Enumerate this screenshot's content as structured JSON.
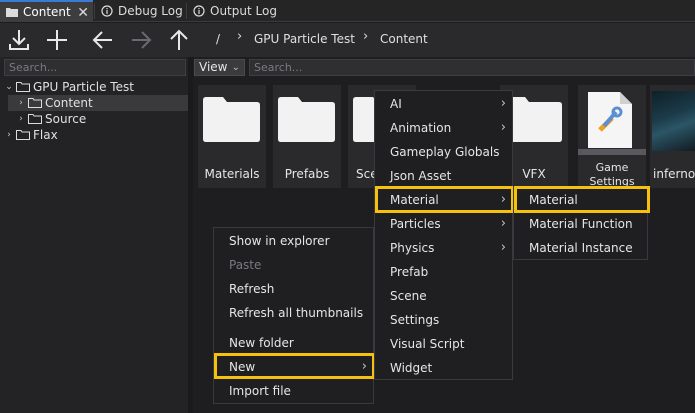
{
  "tabs": [
    {
      "label": "Content",
      "icon": "folder-icon",
      "active": true
    },
    {
      "label": "Debug Log",
      "icon": "info-icon",
      "active": false
    },
    {
      "label": "Output Log",
      "icon": "info-icon",
      "active": false
    }
  ],
  "tab_close": "✕",
  "toolbar": {
    "buttons": [
      "import-icon",
      "add-icon",
      "back-icon",
      "forward-icon",
      "up-icon"
    ],
    "breadcrumb": [
      "/",
      "GPU Particle Test",
      "Content"
    ]
  },
  "left": {
    "search_placeholder": "Search...",
    "tree": [
      {
        "label": "GPU Particle Test",
        "expanded": true
      },
      {
        "label": "Content",
        "selected": true
      },
      {
        "label": "Source"
      },
      {
        "label": "Flax"
      }
    ]
  },
  "content": {
    "view_label": "View",
    "search_placeholder": "Search...",
    "items": [
      {
        "label": "Materials"
      },
      {
        "label": "Prefabs"
      },
      {
        "label": "Sce"
      },
      {
        "label": "VFX"
      },
      {
        "label": "Game\nSettings"
      },
      {
        "label": "inferno-t"
      }
    ]
  },
  "context_menu": {
    "items": [
      {
        "label": "Show in explorer"
      },
      {
        "label": "Paste",
        "disabled": true
      },
      {
        "label": "Refresh"
      },
      {
        "label": "Refresh all thumbnails"
      },
      {
        "label": "New folder"
      },
      {
        "label": "New",
        "submenu": true,
        "highlighted": true
      },
      {
        "label": "Import file"
      }
    ]
  },
  "new_menu": {
    "items": [
      {
        "label": "AI",
        "submenu": true
      },
      {
        "label": "Animation",
        "submenu": true
      },
      {
        "label": "Gameplay Globals"
      },
      {
        "label": "Json Asset"
      },
      {
        "label": "Material",
        "submenu": true,
        "highlighted": true
      },
      {
        "label": "Particles",
        "submenu": true
      },
      {
        "label": "Physics",
        "submenu": true
      },
      {
        "label": "Prefab"
      },
      {
        "label": "Scene"
      },
      {
        "label": "Settings"
      },
      {
        "label": "Visual Script"
      },
      {
        "label": "Widget"
      }
    ]
  },
  "material_menu": {
    "items": [
      {
        "label": "Material",
        "highlighted": true
      },
      {
        "label": "Material Function"
      },
      {
        "label": "Material Instance"
      }
    ]
  },
  "colors": {
    "highlight": "#f4c10f",
    "accent": "#3a7bd5"
  }
}
